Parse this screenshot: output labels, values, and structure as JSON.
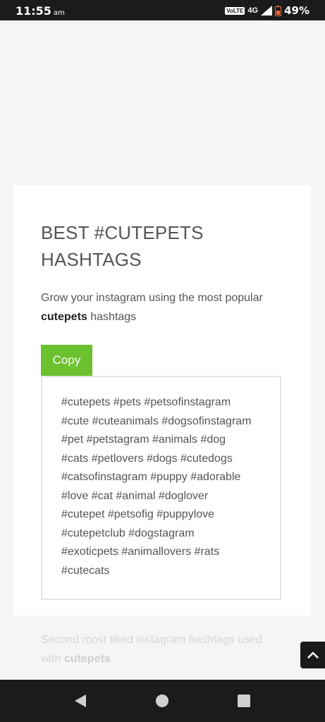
{
  "status_bar": {
    "time": "11:55",
    "ampm": "am",
    "volte": "VoLTE",
    "network": "4G",
    "battery": "49%"
  },
  "card": {
    "title_line1": "BEST #CUTEPETS",
    "title_line2": "HASHTAGS",
    "subtitle_prefix": "Grow your instagram using the most popular",
    "subtitle_bold": "cutepets",
    "subtitle_suffix": " hashtags",
    "copy_label": "Copy",
    "hashtags": [
      "#cutepets #pets #petsofinstagram",
      "#cute #cuteanimals #dogsofinstagram",
      "#pet #petstagram #animals #dog",
      "#cats #petlovers #dogs #cutedogs",
      "#catsofinstagram #puppy #adorable",
      "#love #cat #animal #doglover",
      "#cutepet #petsofig #puppylove",
      "#cutepetclub #dogstagram",
      "#exoticpets #animallovers #rats",
      "#cutecats"
    ]
  },
  "next_section": {
    "text_prefix": "Second most liked instagram hashtags used",
    "text_prefix2": "with ",
    "text_bold": "cutepets"
  },
  "colors": {
    "accent": "#6cc12f",
    "status_bar": "#1b1b1b"
  },
  "icons": {
    "scroll_top": "chevron-up-icon",
    "back": "back-triangle-icon",
    "home": "home-circle-icon",
    "recents": "recents-square-icon"
  }
}
